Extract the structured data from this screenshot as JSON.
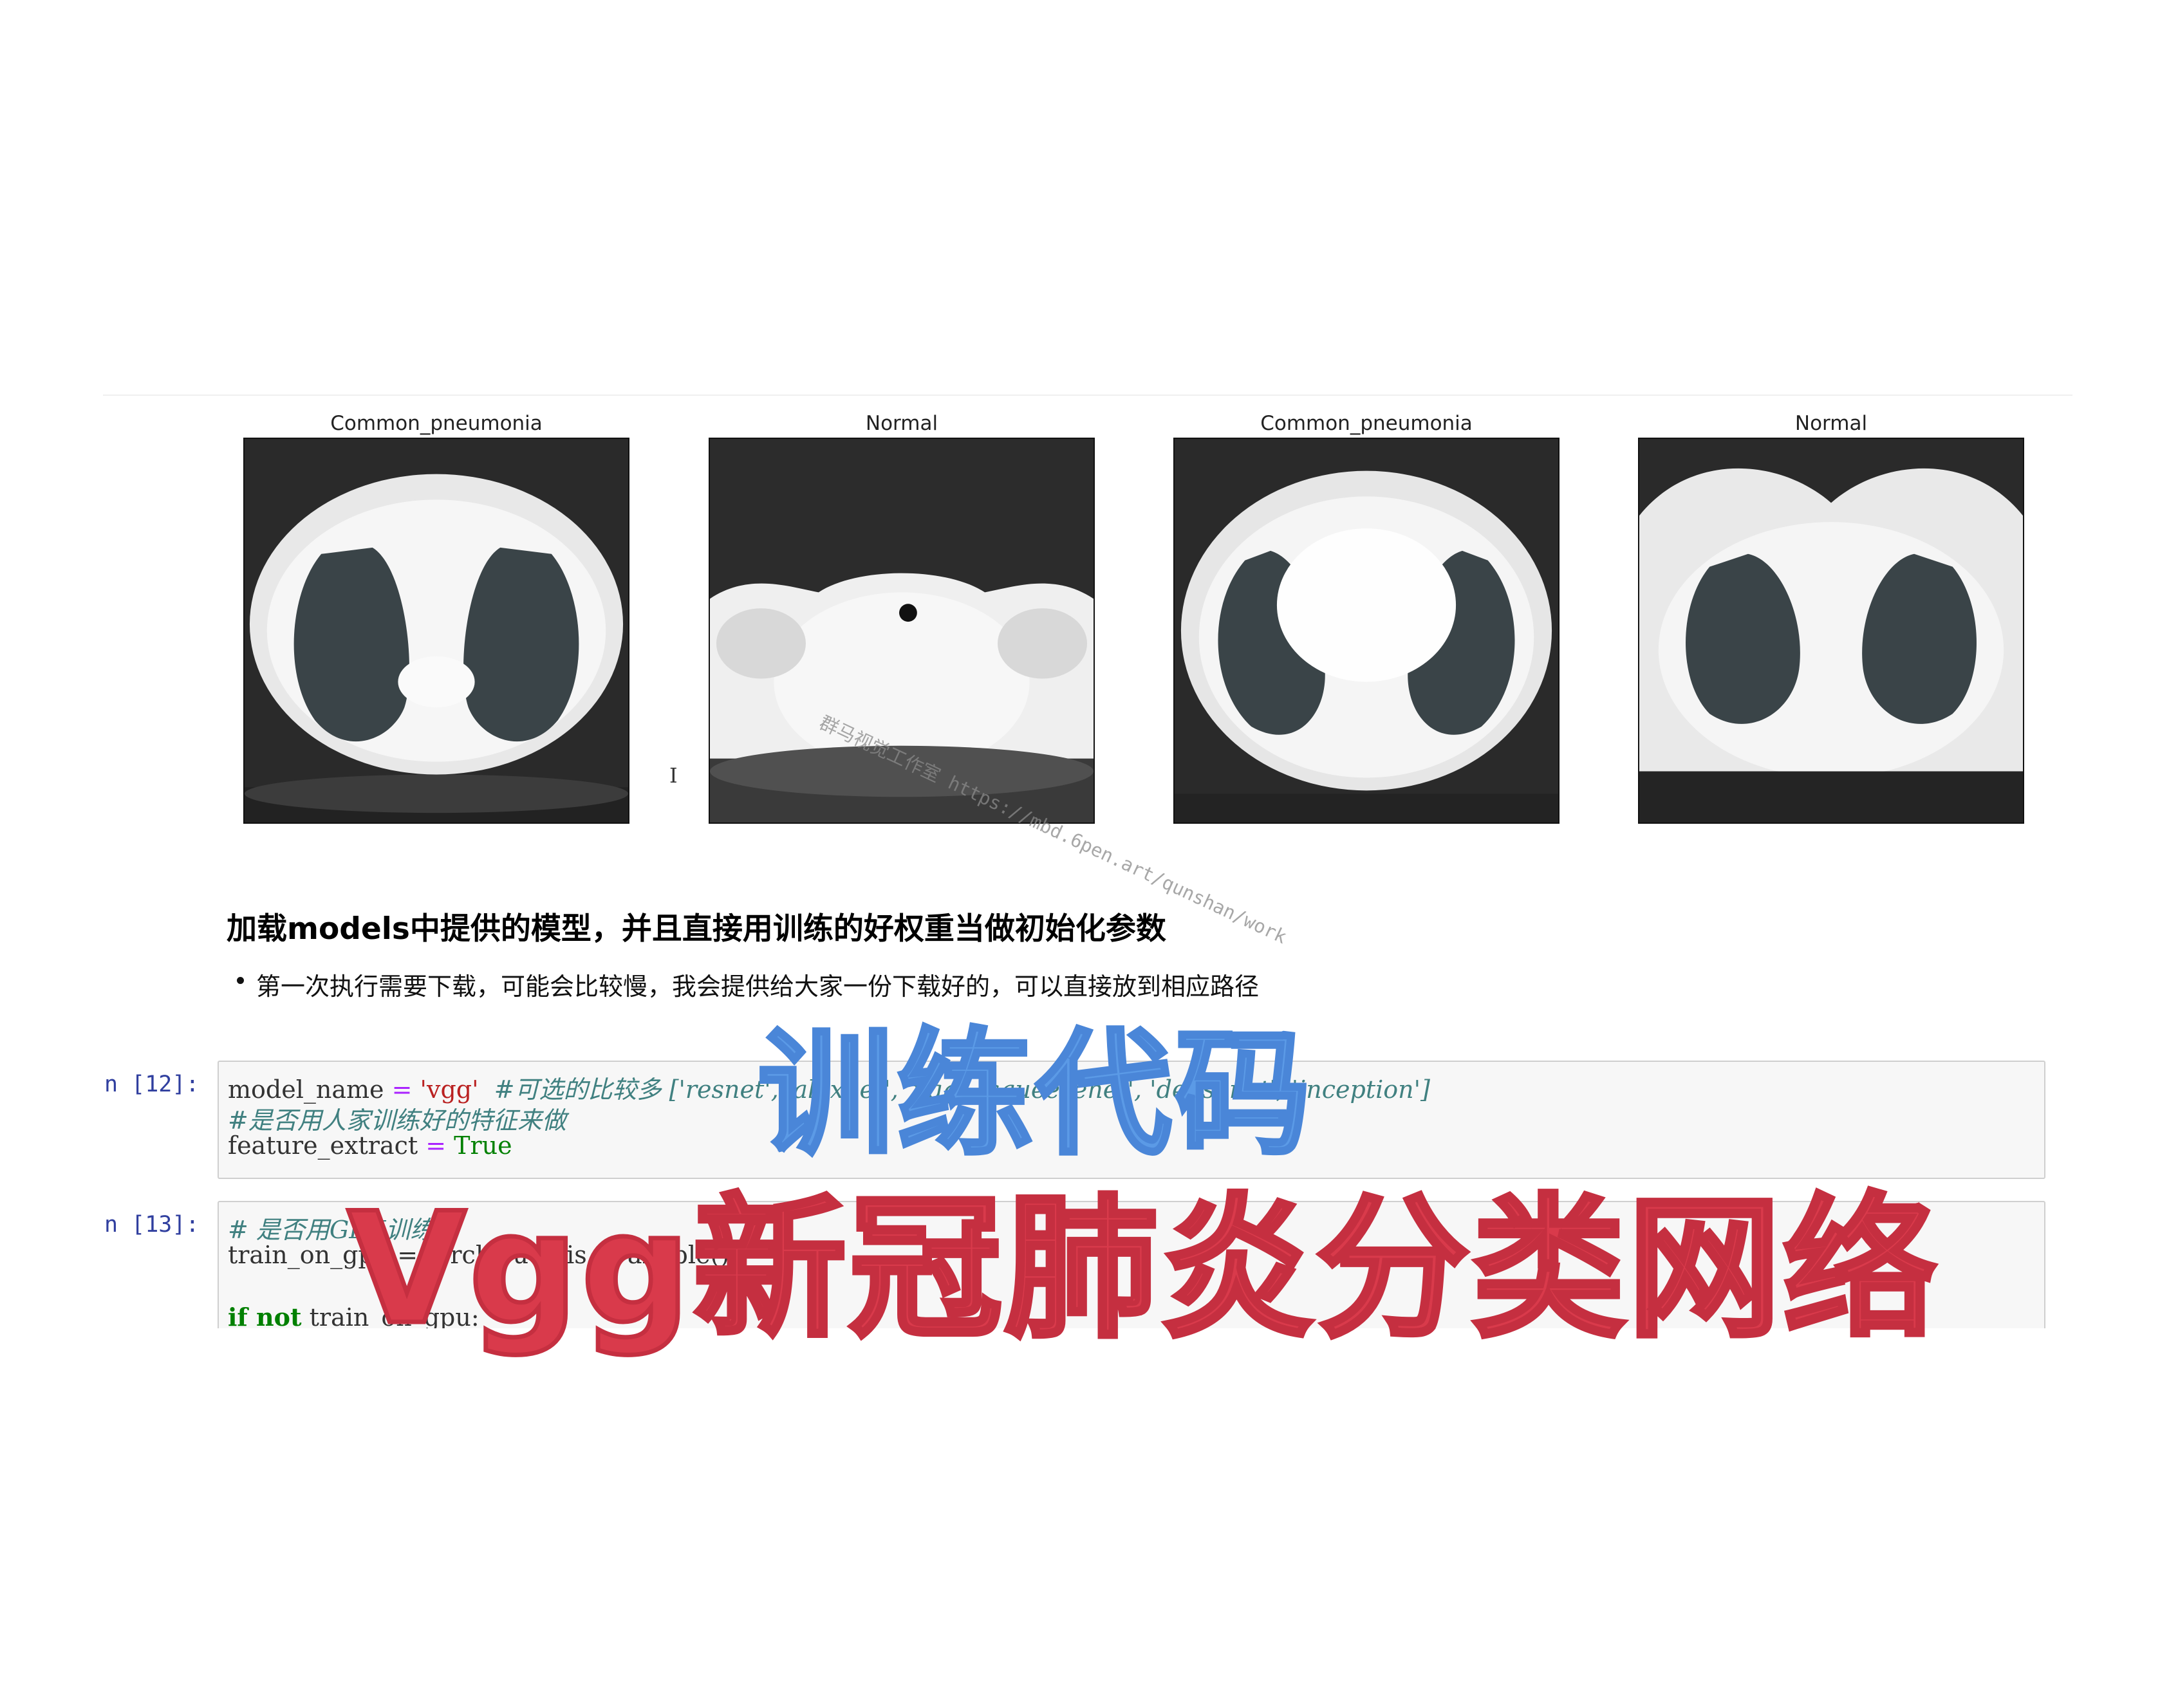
{
  "images": [
    {
      "label": "Common_pneumonia"
    },
    {
      "label": "Normal"
    },
    {
      "label": "Common_pneumonia"
    },
    {
      "label": "Normal"
    }
  ],
  "cursor_glyph": "I",
  "markdown": {
    "heading": "加载models中提供的模型，并且直接用训练的好权重当做初始化参数",
    "bullet": "第一次执行需要下载，可能会比较慢，我会提供给大家一份下载好的，可以直接放到相应路径"
  },
  "cells": [
    {
      "prompt": "n  [12]:",
      "lines": {
        "l1_name": "model_name ",
        "l1_eq": "=",
        "l1_str": " 'vgg'",
        "l1_comment": "  #可选的比较多 ['resnet', 'alexnet', 'vgg', 'squeezenet', 'densenet', 'inception']",
        "l2_comment": "#是否用人家训练好的特征来做",
        "l3_name": "feature_extract ",
        "l3_eq": "=",
        "l3_kw": " True"
      }
    },
    {
      "prompt": "n  [13]:",
      "lines": {
        "l1_comment": "# 是否用GPU训练",
        "l2_code": "train_on_gpu = torch.cuda.is_available()",
        "l4_kw": "if not",
        "l4_code": " train_on_gpu:"
      }
    }
  ],
  "overlay": {
    "title_blue": "训练代码",
    "title_red": "Vgg新冠肺炎分类网络"
  },
  "watermark": "群马视觉工作室 https://mbd.6pen.art/qunshan/work"
}
